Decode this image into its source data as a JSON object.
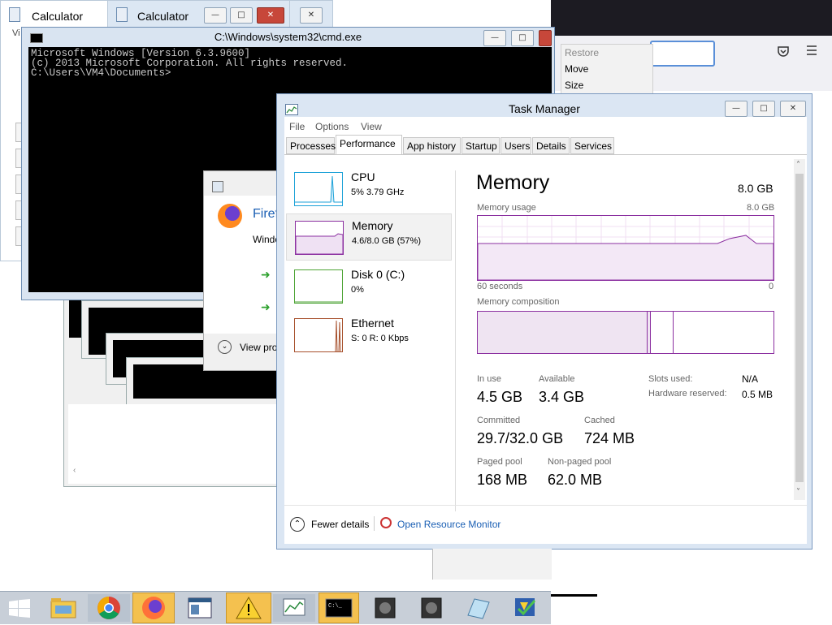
{
  "background_firefox": {
    "icons": [
      "pocket-icon",
      "hamburger-menu-icon"
    ]
  },
  "context_menu": {
    "items": [
      "Restore",
      "Move",
      "Size"
    ]
  },
  "calculator_windows": [
    {
      "title": "Calculator",
      "menu_letter": "Vi"
    },
    {
      "title": "Calculator"
    }
  ],
  "cmd": {
    "title": "C:\\Windows\\system32\\cmd.exe",
    "lines": [
      "Microsoft Windows [Version 6.3.9600]",
      "(c) 2013 Microsoft Corporation. All rights reserved.",
      "",
      "C:\\Users\\VM4\\Documents>"
    ]
  },
  "firefox_dialog": {
    "title_partial": "Firef",
    "sub_partial": "Windo",
    "view_partial": "View pro"
  },
  "task_manager": {
    "title": "Task Manager",
    "menu": [
      "File",
      "Options",
      "View"
    ],
    "tabs": [
      "Processes",
      "Performance",
      "App history",
      "Startup",
      "Users",
      "Details",
      "Services"
    ],
    "active_tab": "Performance",
    "resources": [
      {
        "name": "CPU",
        "sub": "5%  3.79 GHz",
        "color": "#1da2d8"
      },
      {
        "name": "Memory",
        "sub": "4.6/8.0 GB (57%)",
        "color": "#8b2fa0"
      },
      {
        "name": "Disk 0 (C:)",
        "sub": "0%",
        "color": "#4da334"
      },
      {
        "name": "Ethernet",
        "sub": "S: 0  R: 0 Kbps",
        "color": "#a7502c"
      }
    ],
    "memory": {
      "heading": "Memory",
      "total": "8.0 GB",
      "usage_label": "Memory usage",
      "usage_max": "8.0 GB",
      "time_left": "60 seconds",
      "time_right": "0",
      "composition_label": "Memory composition",
      "in_use_label": "In use",
      "in_use": "4.5 GB",
      "available_label": "Available",
      "available": "3.4 GB",
      "slots_label": "Slots used:",
      "slots": "N/A",
      "hw_reserved_label": "Hardware reserved:",
      "hw_reserved": "0.5 MB",
      "committed_label": "Committed",
      "committed": "29.7/32.0 GB",
      "cached_label": "Cached",
      "cached": "724 MB",
      "paged_label": "Paged pool",
      "paged": "168 MB",
      "nonpaged_label": "Non-paged pool",
      "nonpaged": "62.0 MB",
      "usage_fraction": 0.57
    },
    "fewer_details": "Fewer details",
    "open_resource_monitor": "Open Resource Monitor"
  },
  "taskbar": {
    "items": [
      "start-button",
      "file-explorer-icon",
      "chrome-icon",
      "firefox-icon",
      "app-window-icon",
      "warning-icon",
      "task-manager-icon",
      "cmd-icon",
      "app-icon-1",
      "app-icon-2",
      "notepad-icon",
      "app-icon-3"
    ]
  },
  "colors": {
    "memory_accent": "#8b2fa0",
    "link": "#1a5fb4",
    "close_button": "#c7473a"
  }
}
